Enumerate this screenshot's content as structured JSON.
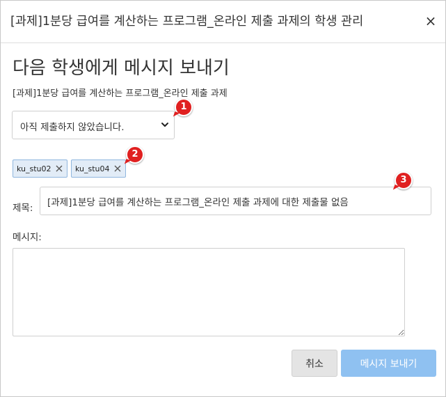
{
  "dialog": {
    "title": "[과제]1분당 급여를 계산하는 프로그램_온라인 제출 과제의 학생 관리",
    "close_label": "×",
    "heading": "다음 학생에게 메시지 보내기",
    "subheading": "[과제]1분당 급여를 계산하는 프로그램_온라인 제출 과제"
  },
  "filter": {
    "selected": "아직 제출하지 않았습니다."
  },
  "recipients": [
    {
      "label": "ku_stu02"
    },
    {
      "label": "ku_stu04"
    }
  ],
  "subject": {
    "label": "제목:",
    "value": "[과제]1분당 급여를 계산하는 프로그램_온라인 제출 과제에 대한 제출물 없음"
  },
  "message": {
    "label": "메시지:",
    "value": ""
  },
  "buttons": {
    "cancel": "취소",
    "send": "메시지 보내기"
  },
  "markers": [
    "1",
    "2",
    "3"
  ],
  "colors": {
    "send_button": "#8fc1f1",
    "tag_bg": "#e2ecf7",
    "tag_border": "#8fb6de",
    "marker": "#e02020"
  },
  "icons": {
    "select_arrow": "chevron-down-icon",
    "tag_remove": "close-icon",
    "dialog_close": "close-icon"
  }
}
